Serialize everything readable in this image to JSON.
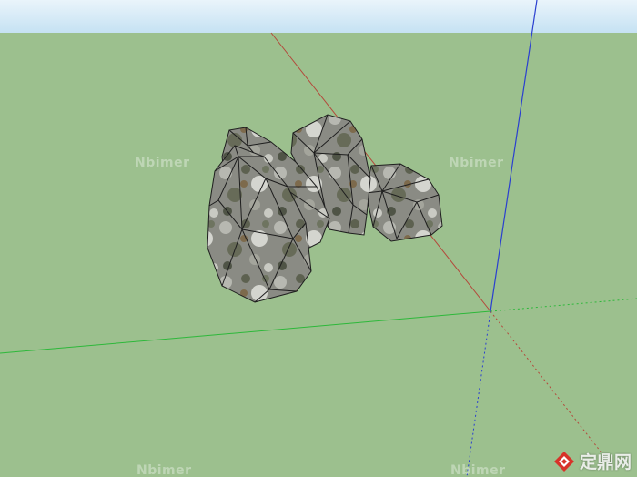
{
  "scene": {
    "model": "rock-group",
    "colors": {
      "sky_top": "#eaf4fb",
      "ground": "#9cc08e",
      "axis_red": "#b4473a",
      "axis_green": "#2db83a",
      "axis_blue": "#2a3fd0",
      "rock_base": "#7d7e76",
      "edge": "#1e1e1e"
    }
  },
  "watermarks": [
    "Nbimer",
    "Nbimer",
    "Nbimer",
    "Nbimer"
  ],
  "logo": {
    "text": "定鼎网"
  }
}
